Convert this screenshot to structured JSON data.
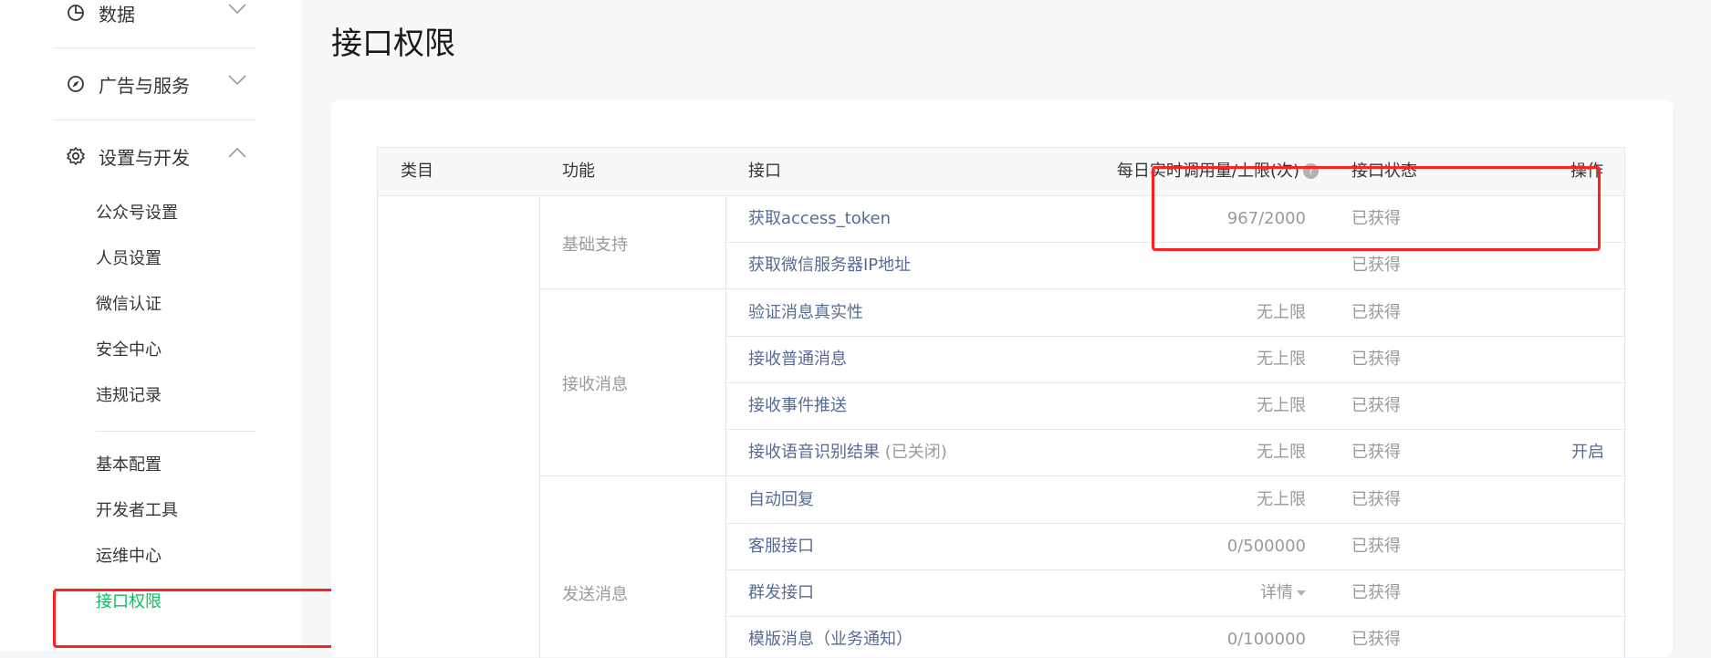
{
  "sidebar": {
    "groups": [
      {
        "label": "数据",
        "icon": "pie-chart-icon",
        "expanded": false
      },
      {
        "label": "广告与服务",
        "icon": "compass-icon",
        "expanded": false
      },
      {
        "label": "设置与开发",
        "icon": "gear-icon",
        "expanded": true
      }
    ],
    "items_settings": [
      {
        "label": "公众号设置"
      },
      {
        "label": "人员设置"
      },
      {
        "label": "微信认证"
      },
      {
        "label": "安全中心"
      },
      {
        "label": "违规记录"
      }
    ],
    "items_dev": [
      {
        "label": "基本配置"
      },
      {
        "label": "开发者工具"
      },
      {
        "label": "运维中心"
      },
      {
        "label": "接口权限",
        "active": true
      }
    ]
  },
  "page": {
    "title": "接口权限"
  },
  "table": {
    "headers": {
      "category": "类目",
      "function": "功能",
      "api": "接口",
      "limit": "每日实时调用量/上限(次)",
      "status": "接口状态",
      "action": "操作"
    },
    "functions": [
      {
        "name": "基础支持"
      },
      {
        "name": "接收消息"
      },
      {
        "name": "发送消息"
      }
    ],
    "rows": [
      {
        "api": "获取access_token",
        "note": "",
        "limit": "967/2000",
        "status": "已获得",
        "action": ""
      },
      {
        "api": "获取微信服务器IP地址",
        "note": "",
        "limit": "",
        "status": "已获得",
        "action": ""
      },
      {
        "api": "验证消息真实性",
        "note": "",
        "limit": "无上限",
        "status": "已获得",
        "action": ""
      },
      {
        "api": "接收普通消息",
        "note": "",
        "limit": "无上限",
        "status": "已获得",
        "action": ""
      },
      {
        "api": "接收事件推送",
        "note": "",
        "limit": "无上限",
        "status": "已获得",
        "action": ""
      },
      {
        "api": "接收语音识别结果",
        "note": " (已关闭)",
        "limit": "无上限",
        "status": "已获得",
        "action": "开启"
      },
      {
        "api": "自动回复",
        "note": "",
        "limit": "无上限",
        "status": "已获得",
        "action": ""
      },
      {
        "api": "客服接口",
        "note": "",
        "limit": "0/500000",
        "status": "已获得",
        "action": ""
      },
      {
        "api": "群发接口",
        "note": "",
        "limit": "详情",
        "status": "已获得",
        "action": ""
      },
      {
        "api": "模版消息（业务通知）",
        "note": "",
        "limit": "0/100000",
        "status": "已获得",
        "action": ""
      }
    ]
  },
  "colors": {
    "accent": "#07c160",
    "link": "#576b95",
    "highlight_box": "#ff2222"
  }
}
